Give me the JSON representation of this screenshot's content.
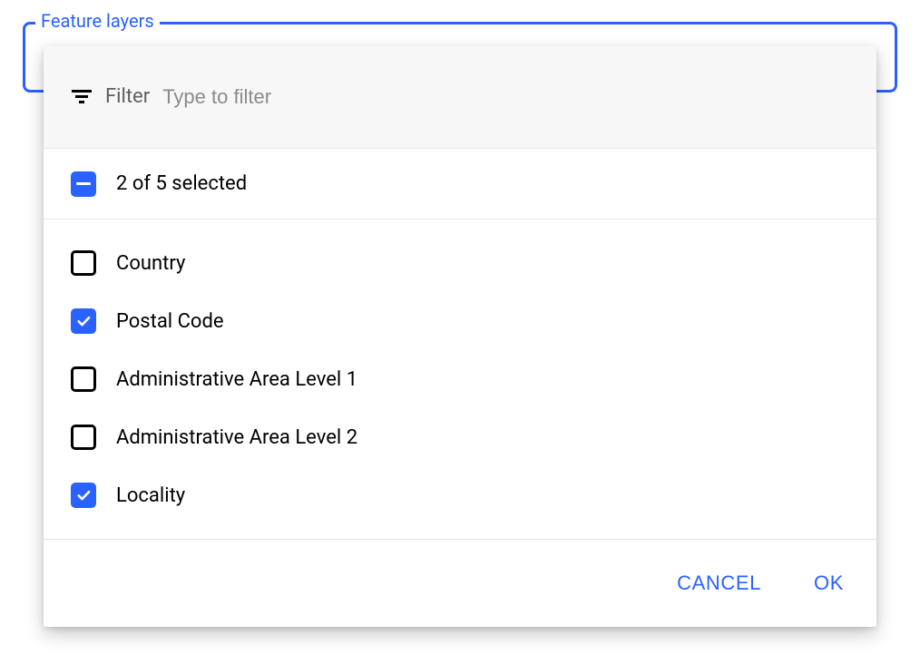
{
  "field": {
    "legend": "Feature layers"
  },
  "filter": {
    "label": "Filter",
    "placeholder": "Type to filter",
    "value": ""
  },
  "summary": {
    "text": "2 of 5 selected"
  },
  "options": [
    {
      "label": "Country",
      "checked": false
    },
    {
      "label": "Postal Code",
      "checked": true
    },
    {
      "label": "Administrative Area Level 1",
      "checked": false
    },
    {
      "label": "Administrative Area Level 2",
      "checked": false
    },
    {
      "label": "Locality",
      "checked": true
    }
  ],
  "actions": {
    "cancel": "CANCEL",
    "ok": "OK"
  },
  "colors": {
    "accent": "#2962ff"
  }
}
